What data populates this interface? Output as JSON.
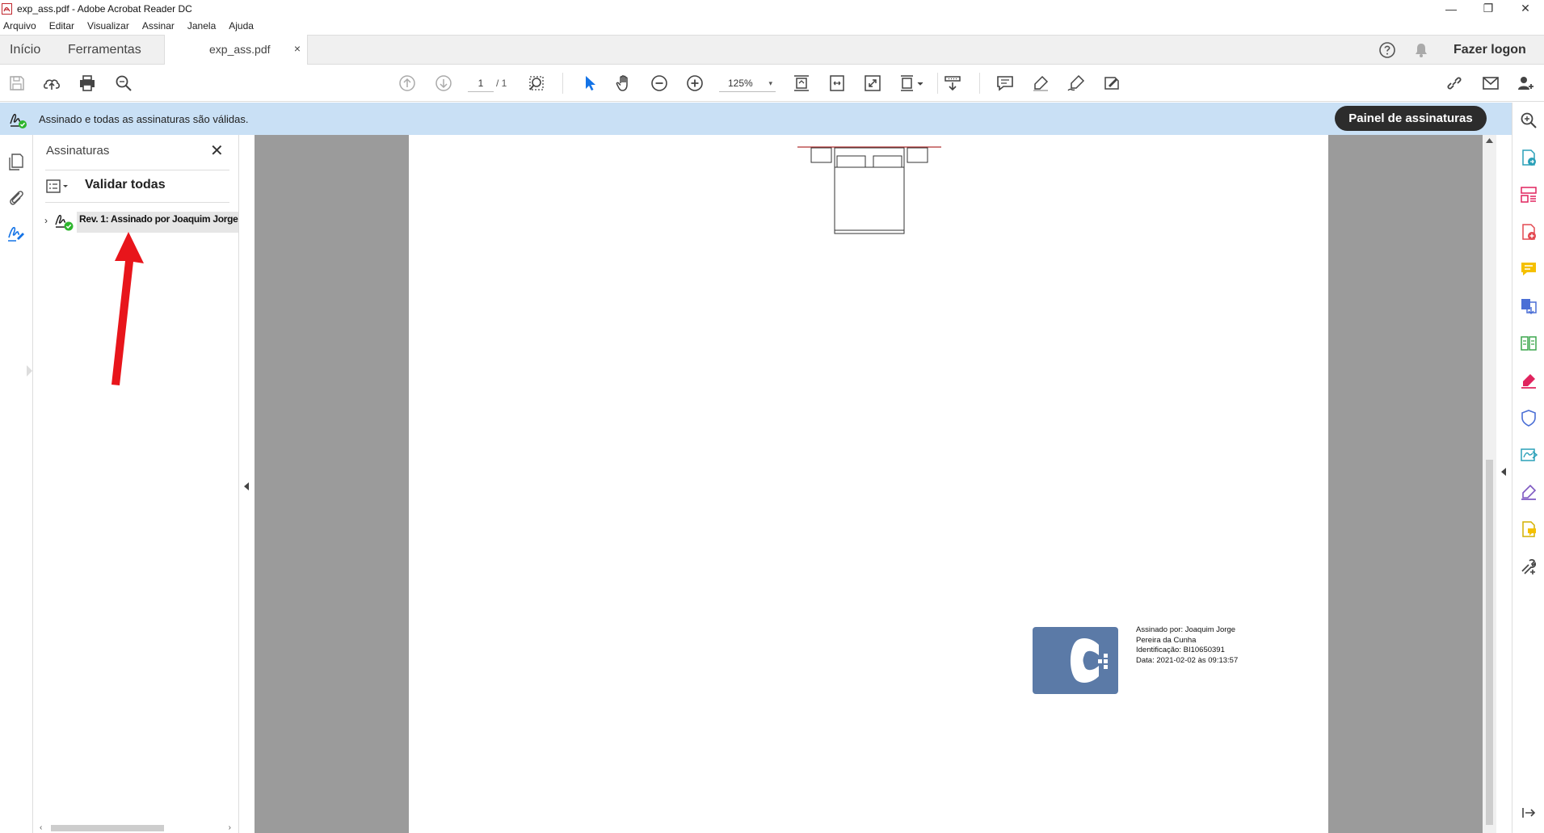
{
  "window": {
    "title": "exp_ass.pdf - Adobe Acrobat Reader DC",
    "minimize_glyph": "—",
    "restore_glyph": "❐",
    "close_glyph": "✕"
  },
  "menu": [
    "Arquivo",
    "Editar",
    "Visualizar",
    "Assinar",
    "Janela",
    "Ajuda"
  ],
  "tabs": {
    "home": "Início",
    "tools": "Ferramentas",
    "document": "exp_ass.pdf",
    "close_glyph": "×",
    "login": "Fazer logon"
  },
  "toolbar": {
    "current_page": "1",
    "total_pages": "/ 1",
    "zoom": "125%",
    "zoom_arrow": "▾"
  },
  "signature_bar": {
    "message": "Assinado e todas as assinaturas são válidas.",
    "panel_button": "Painel de assinaturas"
  },
  "signatures_panel": {
    "title": "Assinaturas",
    "close_glyph": "✕",
    "validate_all": "Validar todas",
    "expand_glyph": "›",
    "items": [
      {
        "label": "Rev. 1: Assinado por Joaquim Jorge"
      }
    ],
    "scroll_left": "‹",
    "scroll_right": "›"
  },
  "stamp": {
    "lines": [
      "Assinado por: Joaquim Jorge",
      "Pereira da Cunha",
      "Identificação: BI10650391",
      "Data: 2021-02-02 às 09:13:57"
    ]
  },
  "colors": {
    "sig_bar_bg": "#c9e0f5",
    "panel_button_bg": "#2c2c2c",
    "stamp_blue": "#5b7aa7",
    "annotation_red": "#e8151b",
    "valid_green": "#2eb52e",
    "select_blue": "#1473e6"
  }
}
